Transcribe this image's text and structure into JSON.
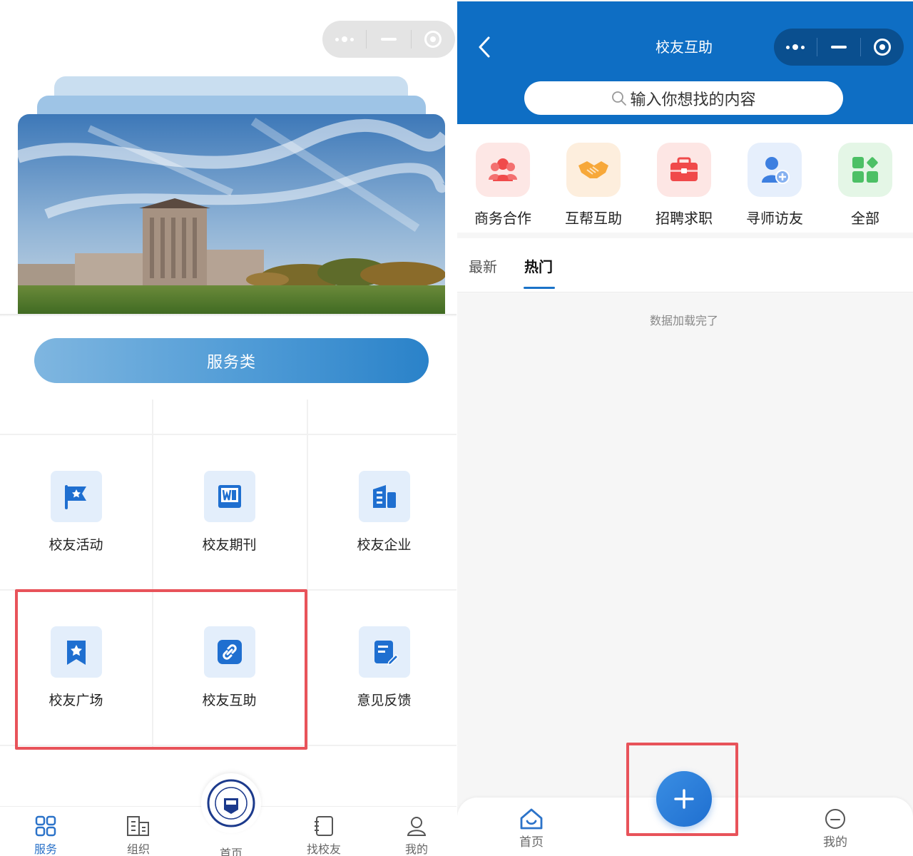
{
  "left": {
    "service_title": "服务类",
    "grid": [
      {
        "label": "校友活动",
        "icon": "flag-icon"
      },
      {
        "label": "校友期刊",
        "icon": "journal-icon"
      },
      {
        "label": "校友企业",
        "icon": "building-icon"
      },
      {
        "label": "校友广场",
        "icon": "star-bookmark-icon"
      },
      {
        "label": "校友互助",
        "icon": "link-icon"
      },
      {
        "label": "意见反馈",
        "icon": "feedback-icon"
      }
    ],
    "tabbar": [
      {
        "label": "服务",
        "icon": "grid-icon",
        "active": true
      },
      {
        "label": "组织",
        "icon": "org-building-icon",
        "active": false
      },
      {
        "label": "首页",
        "icon": "university-emblem-icon",
        "active": false
      },
      {
        "label": "找校友",
        "icon": "notebook-icon",
        "active": false
      },
      {
        "label": "我的",
        "icon": "user-icon",
        "active": false
      }
    ]
  },
  "right": {
    "title": "校友互助",
    "search_placeholder": "输入你想找的内容",
    "categories": [
      {
        "label": "商务合作",
        "icon": "people-icon",
        "bg": "#fde7e5",
        "color": "#f04b4b"
      },
      {
        "label": "互帮互助",
        "icon": "handshake-icon",
        "bg": "#fdeedd",
        "color": "#f7a83a"
      },
      {
        "label": "招聘求职",
        "icon": "briefcase-icon",
        "bg": "#fde6e4",
        "color": "#f0494a"
      },
      {
        "label": "寻师访友",
        "icon": "add-user-icon",
        "bg": "#e6effc",
        "color": "#3d7fe0"
      },
      {
        "label": "全部",
        "icon": "apps-icon",
        "bg": "#e4f6e6",
        "color": "#4cc065"
      }
    ],
    "tabs": [
      {
        "label": "最新",
        "active": false
      },
      {
        "label": "热门",
        "active": true
      }
    ],
    "loaded_text": "数据加载完了",
    "tabbar": [
      {
        "label": "首页",
        "icon": "home-icon"
      },
      {
        "label": "我的",
        "icon": "profile-icon"
      }
    ]
  },
  "colors": {
    "primary": "#0e6ec4",
    "accent": "#2c73c9",
    "highlight_box": "#e8535a"
  }
}
